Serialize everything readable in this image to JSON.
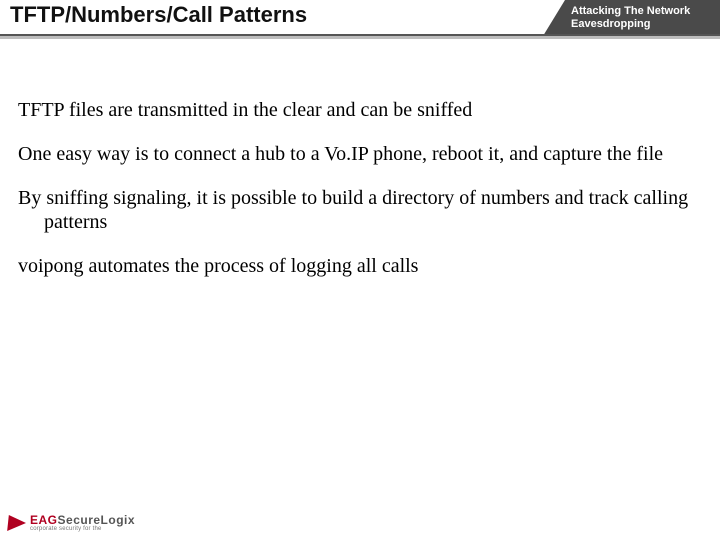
{
  "header": {
    "title": "TFTP/Numbers/Call Patterns",
    "tag_line1": "Attacking The Network",
    "tag_line2": "Eavesdropping"
  },
  "body": {
    "p1": "TFTP files are transmitted in the clear and can be sniffed",
    "p2": "One easy way is to connect a hub to a Vo.IP phone, reboot it, and capture the file",
    "p3": "By sniffing signaling, it is possible to build a directory of numbers and track calling patterns",
    "p4": "voipong automates the process of logging all calls"
  },
  "logo": {
    "brand_part1": "EAG",
    "brand_part2": "SecureLogix",
    "sub": "corporate security for the"
  }
}
